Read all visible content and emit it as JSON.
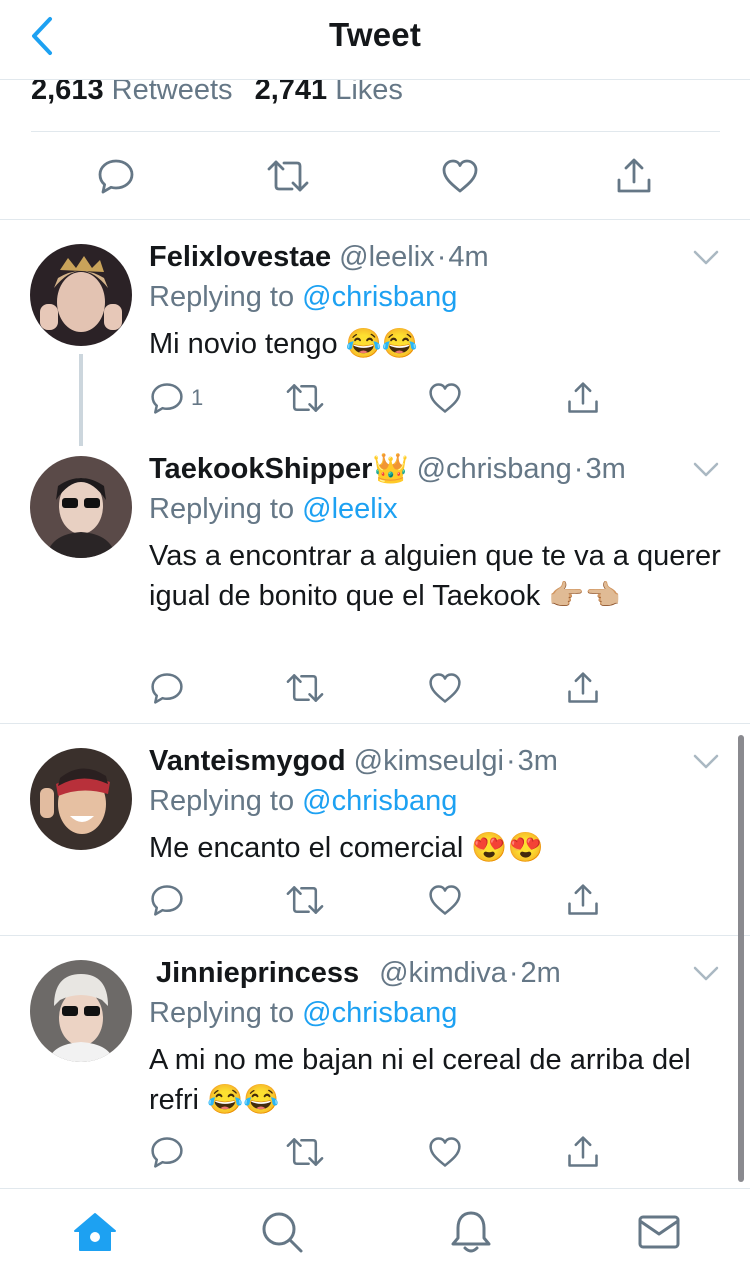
{
  "header": {
    "title": "Tweet"
  },
  "stats": {
    "retweets_count": "2,613",
    "retweets_label": "Retweets",
    "likes_count": "2,741",
    "likes_label": "Likes"
  },
  "colors": {
    "accent": "#1da1f2",
    "secondary_text": "#657786",
    "icon": "#657786",
    "divider": "#e1e8ed"
  },
  "replies": [
    {
      "name": "Felixlovestae",
      "handle": "@leelix",
      "dot": "·",
      "time": "4m",
      "replying_label": "Replying to",
      "replying_to": "@chrisbang",
      "text": "Mi novio tengo 😂😂",
      "reply_count": "1"
    },
    {
      "name": "TaekookShipper👑",
      "handle": "@chrisbang",
      "dot": "·",
      "time": "3m",
      "replying_label": "Replying to",
      "replying_to": "@leelix",
      "text": "Vas a encontrar a alguien que te va a querer igual de bonito que el Taekook 👉🏼👈🏼",
      "reply_count": ""
    },
    {
      "name": "Vanteismygod",
      "handle": "@kimseulgi",
      "dot": "·",
      "time": "3m",
      "replying_label": "Replying to",
      "replying_to": "@chrisbang",
      "text": "Me encanto el comercial 😍😍",
      "reply_count": ""
    },
    {
      "name": "Jinnieprincess",
      "handle": "@kimdiva",
      "dot": "·",
      "time": "2m",
      "replying_label": "Replying to",
      "replying_to": "@chrisbang",
      "text": "A mi no me bajan ni el cereal de arriba del refri 😂😂",
      "reply_count": ""
    }
  ],
  "icons": {
    "back": "chevron-left-icon",
    "reply": "reply-icon",
    "retweet": "retweet-icon",
    "like": "heart-icon",
    "share": "share-icon",
    "caret": "chevron-down-icon",
    "home": "home-icon",
    "search": "search-icon",
    "notifications": "bell-icon",
    "messages": "mail-icon"
  }
}
